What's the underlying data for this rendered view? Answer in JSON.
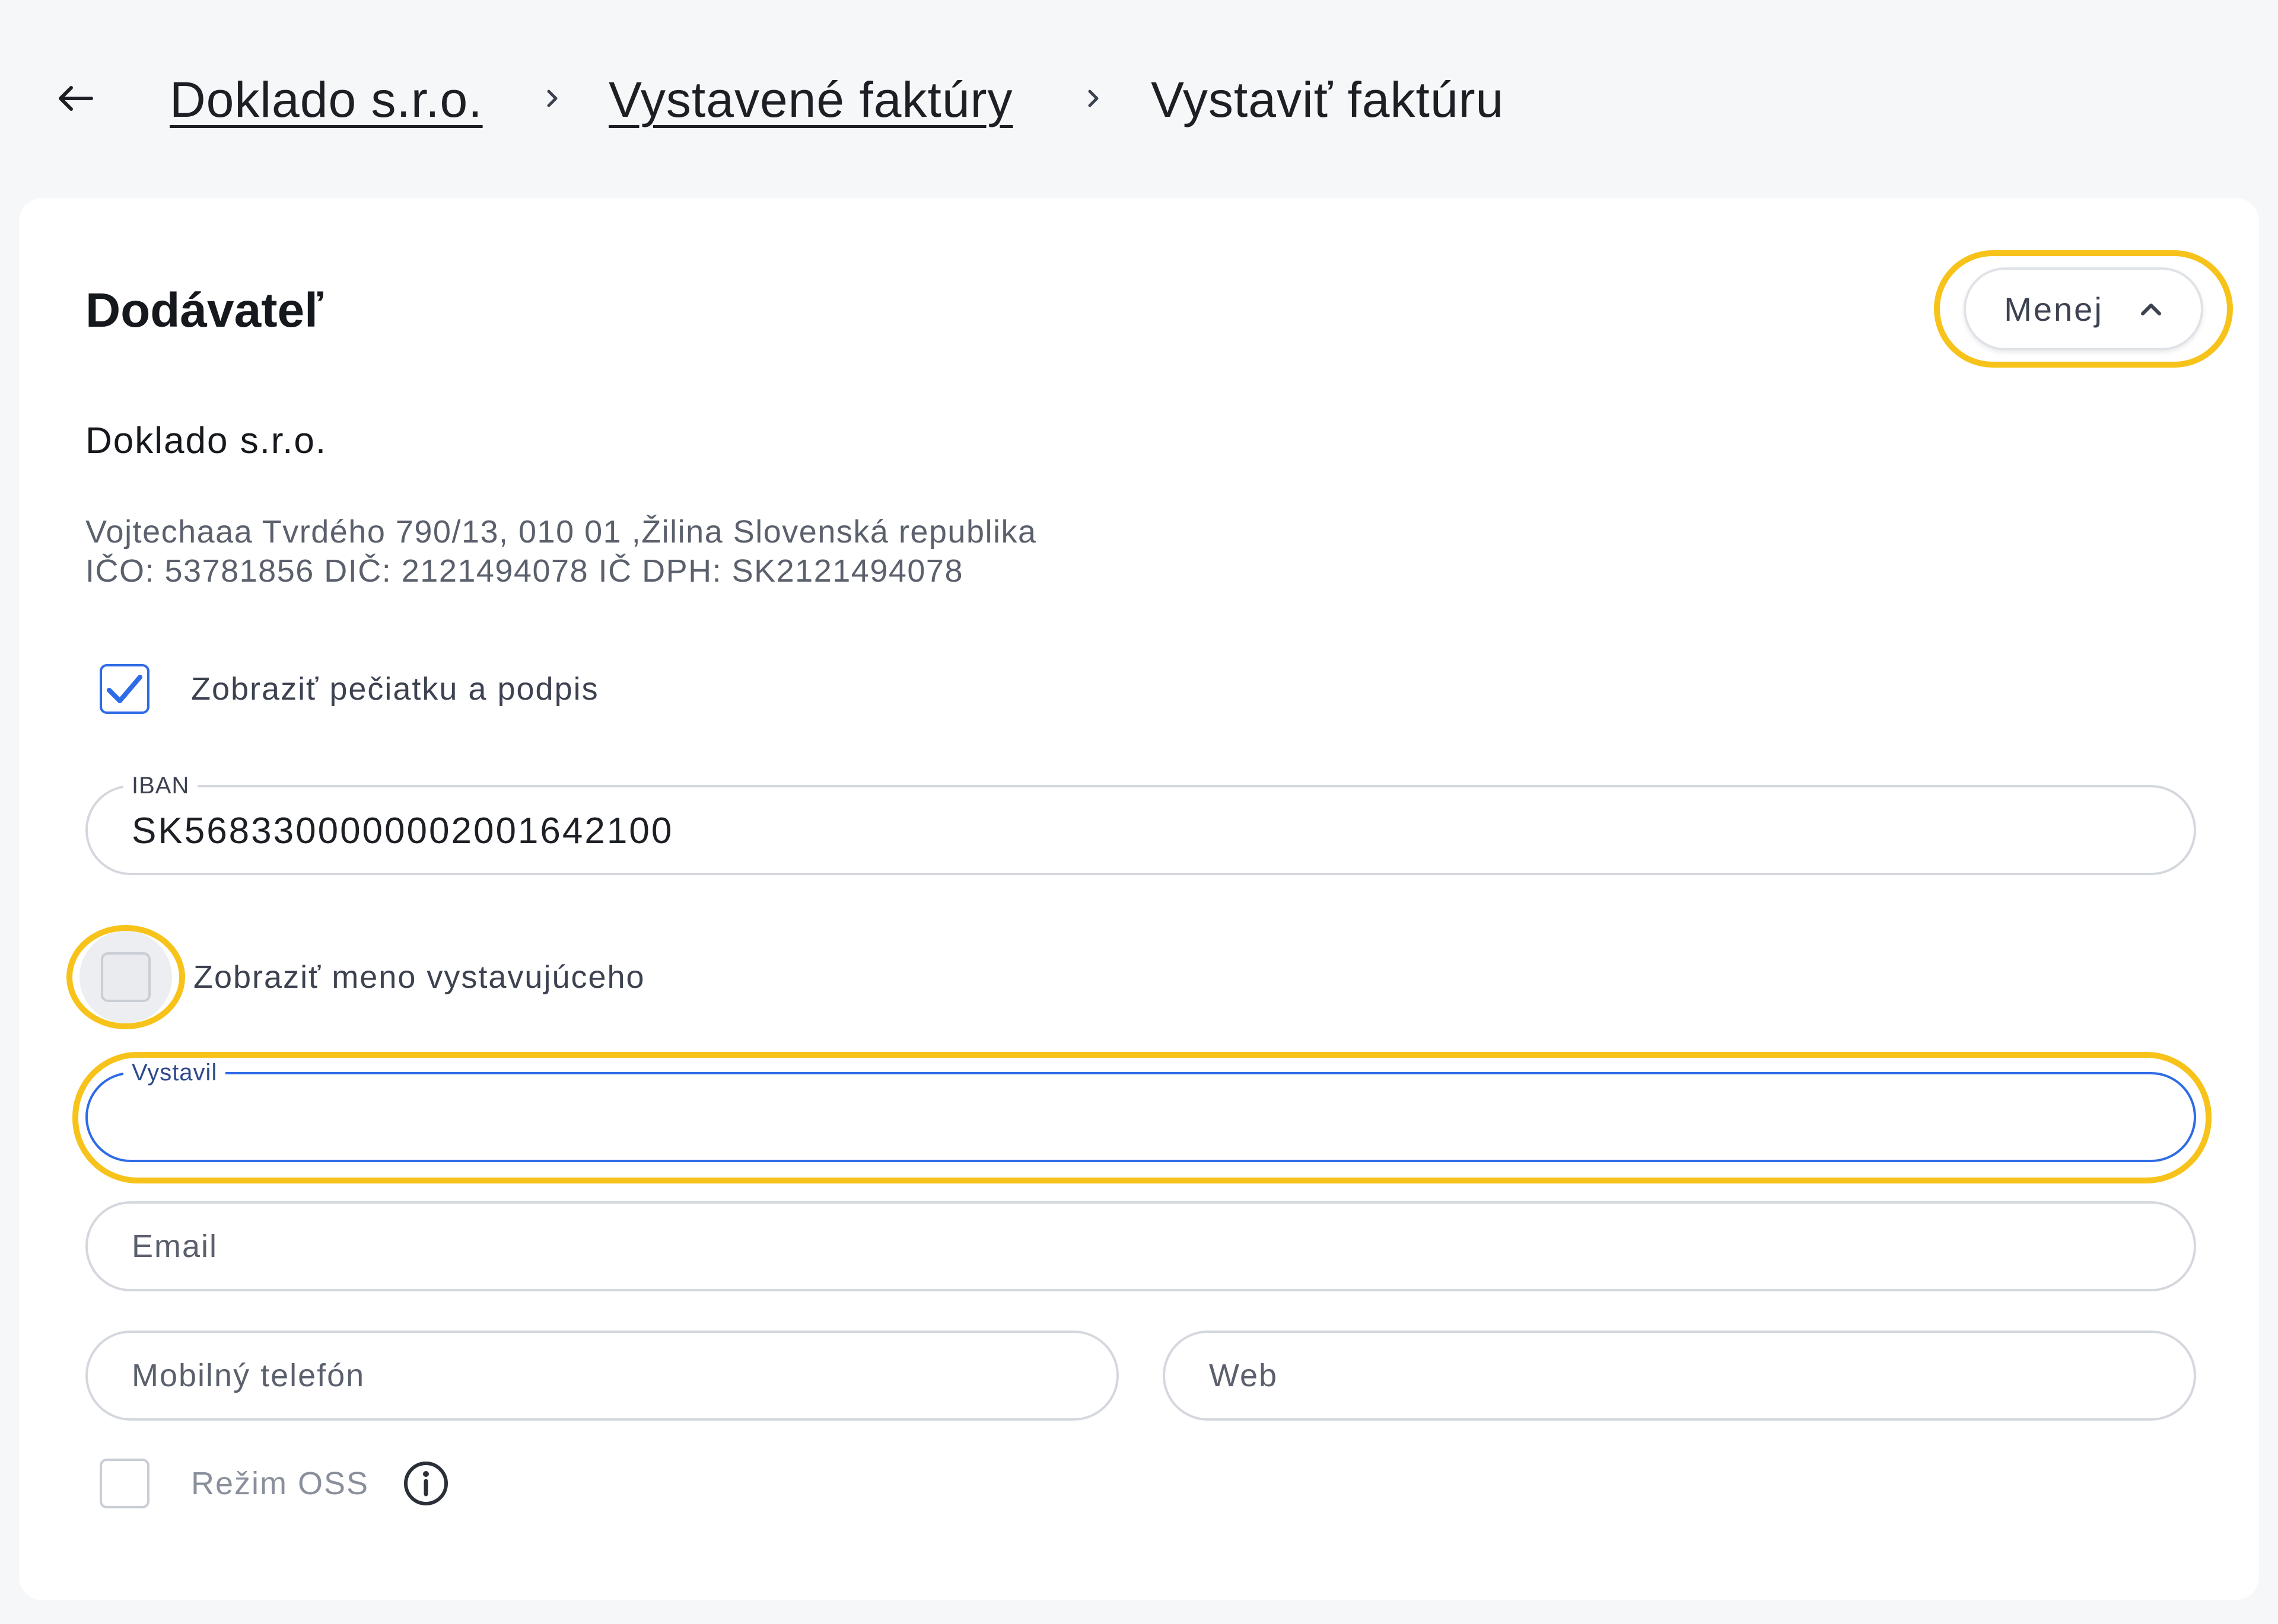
{
  "breadcrumb": {
    "items": [
      "Doklado s.r.o.",
      "Vystavené faktúry",
      "Vystaviť faktúru"
    ]
  },
  "supplier": {
    "title": "Dodávateľ",
    "toggle_label": "Menej",
    "company_name": "Doklado s.r.o.",
    "address": "Vojtechaaa Tvrdého 790/13, 010 01 ,Žilina Slovenská republika",
    "ids": "IČO: 53781856 DIČ: 2121494078 IČ DPH: SK2121494078",
    "show_stamp_label": "Zobraziť pečiatku a podpis",
    "show_stamp_checked": true,
    "iban_label": "IBAN",
    "iban_value": "SK5683300000002001642100",
    "show_issuer_label": "Zobraziť meno vystavujúceho",
    "show_issuer_checked": false,
    "issuer_label": "Vystavil",
    "issuer_value": "",
    "email_placeholder": "Email",
    "phone_placeholder": "Mobilný telefón",
    "web_placeholder": "Web",
    "oss_label": "Režim OSS",
    "oss_checked": false
  },
  "colors": {
    "accent_blue": "#2e6be6",
    "focus_yellow": "#f7c31a",
    "page_bg": "#f5f7f9"
  }
}
